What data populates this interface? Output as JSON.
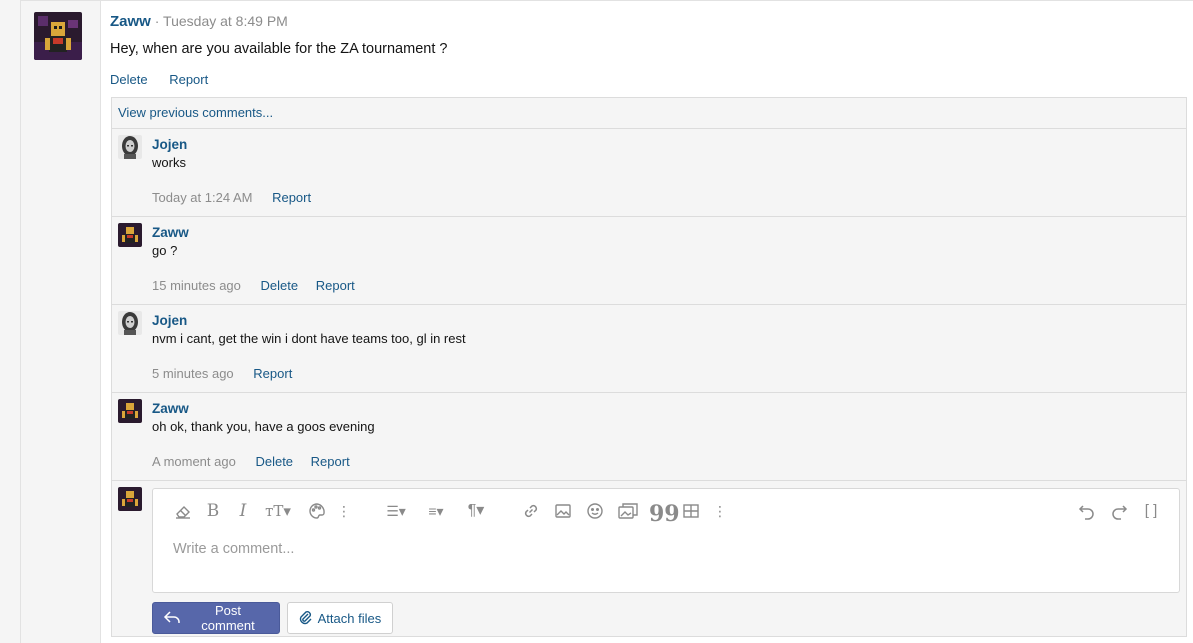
{
  "post": {
    "author": "Zaww",
    "separator": "·",
    "time": "Tuesday at 8:49 PM",
    "body": "Hey, when are you available for the ZA tournament ?",
    "actions": {
      "delete": "Delete",
      "report": "Report"
    }
  },
  "comments": {
    "view_previous": "View previous comments...",
    "items": [
      {
        "author": "Jojen",
        "text": "works",
        "time": "Today at 1:24 AM",
        "delete": "",
        "report": "Report"
      },
      {
        "author": "Zaww",
        "text": "go ?",
        "time": "15 minutes ago",
        "delete": "Delete",
        "report": "Report"
      },
      {
        "author": "Jojen",
        "text": "nvm i cant, get the win i dont have teams too, gl in rest",
        "time": "5 minutes ago",
        "delete": "",
        "report": "Report"
      },
      {
        "author": "Zaww",
        "text": "oh ok, thank you, have a goos evening",
        "time": "A moment ago",
        "delete": "Delete",
        "report": "Report"
      }
    ]
  },
  "editor": {
    "placeholder": "Write a comment...",
    "post_button": "Post comment",
    "attach_button": "Attach files",
    "toolbar_icons": [
      "eraser-icon",
      "bold-icon",
      "italic-icon",
      "text-size-icon",
      "palette-icon",
      "more-vertical-icon",
      "list-icon",
      "align-icon",
      "paragraph-icon",
      "link-icon",
      "image-icon",
      "smiley-icon",
      "media-icon",
      "quote-icon",
      "table-icon",
      "more-vertical-icon",
      "undo-icon",
      "redo-icon",
      "bbcode-toggle-icon"
    ]
  },
  "colors": {
    "link": "#185886",
    "primary_button": "#5767aa",
    "meta_text": "#8c8c8c",
    "panel_bg": "#f5f5f5"
  }
}
